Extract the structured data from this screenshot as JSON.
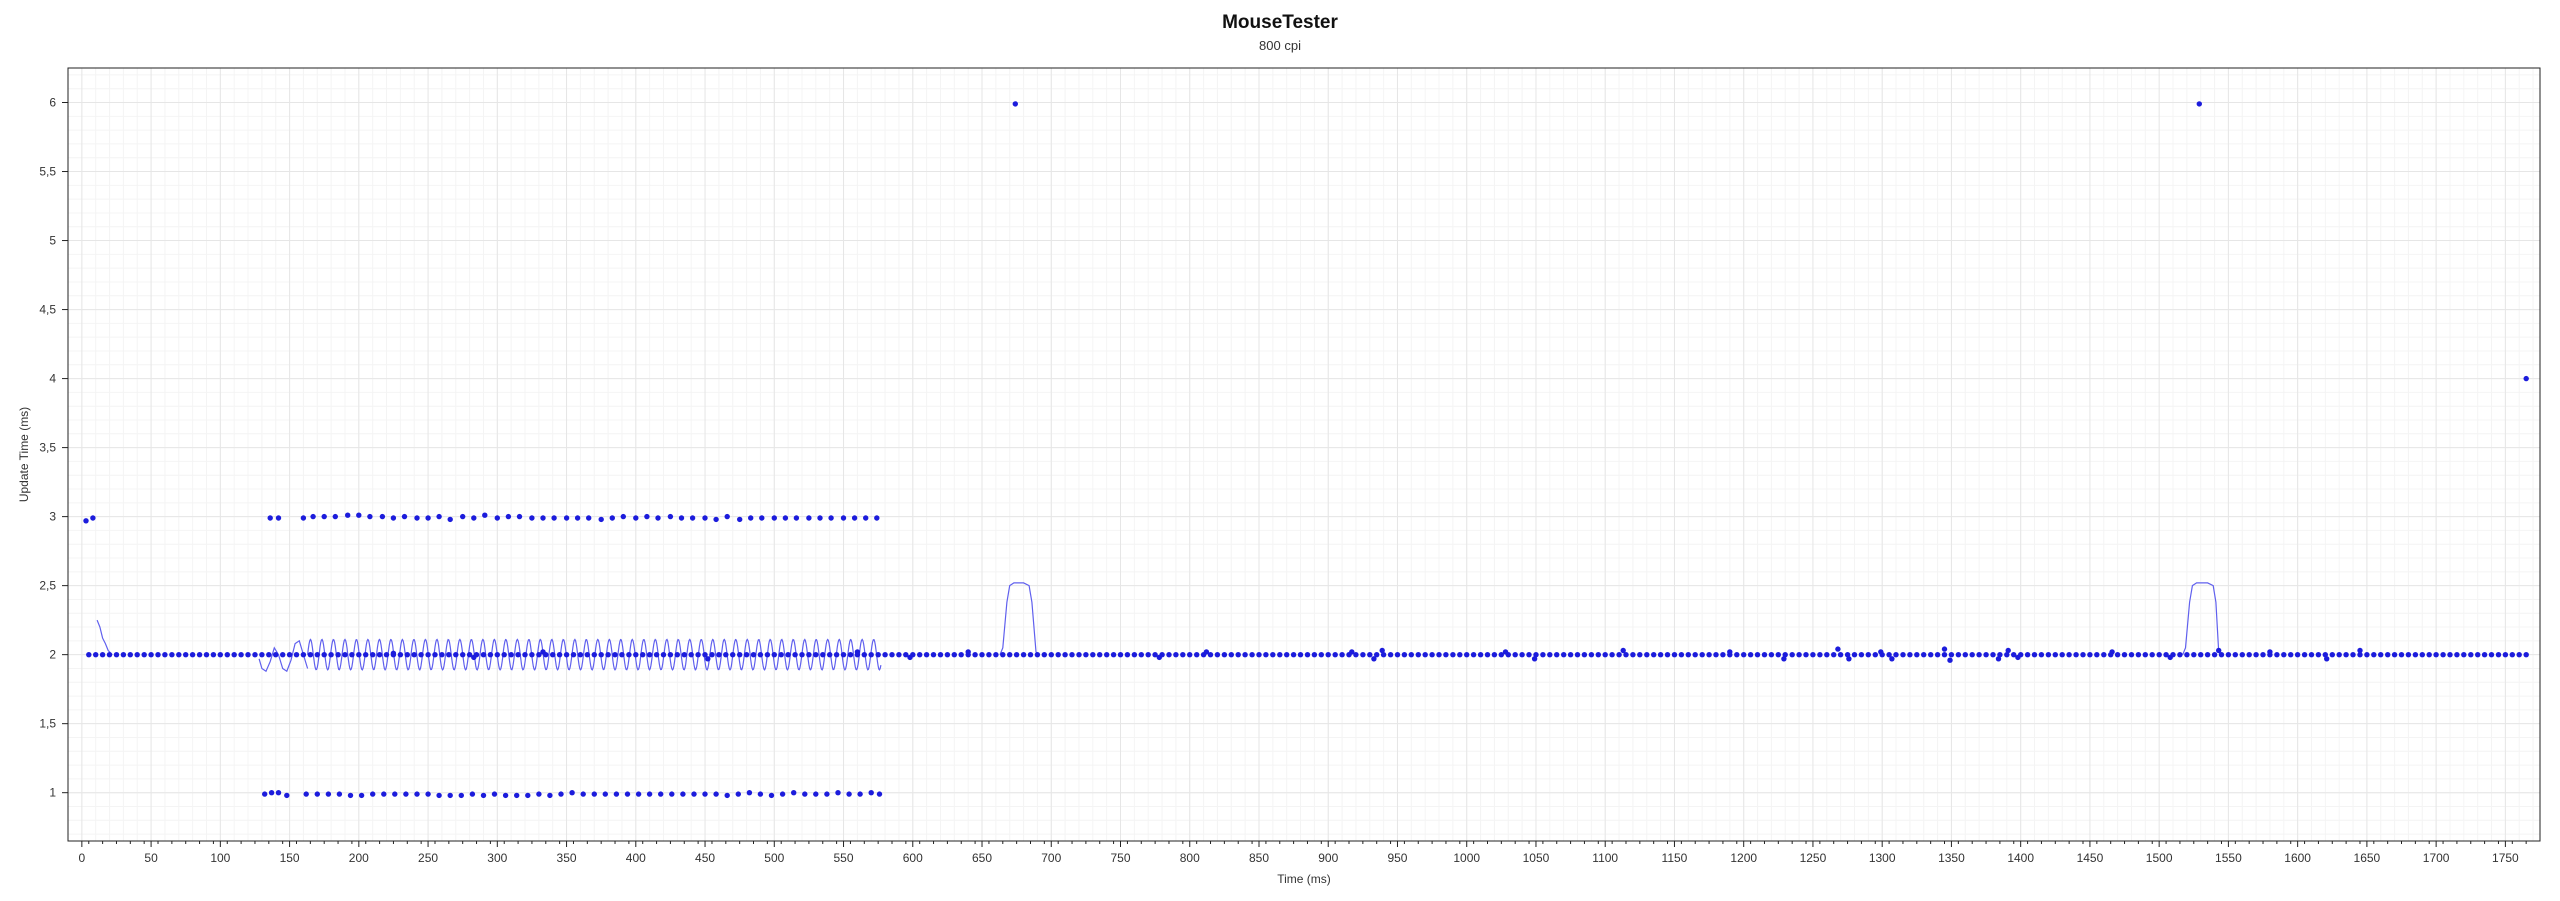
{
  "title": "MouseTester",
  "subtitle": "800 cpi",
  "chart_data": {
    "type": "scatter",
    "title": "MouseTester",
    "subtitle": "800 cpi",
    "xlabel": "Time (ms)",
    "ylabel": "Update Time (ms)",
    "xlim": [
      -10,
      1775
    ],
    "ylim": [
      0.65,
      6.25
    ],
    "grid": true,
    "legend": "none",
    "colors": {
      "series": "#1c1cdc",
      "line": "#6060ee",
      "grid_major": "#e6e6e6",
      "grid_minor": "#f4f4f4"
    },
    "x_ticks": [
      "0",
      "50",
      "100",
      "150",
      "200",
      "250",
      "300",
      "350",
      "400",
      "450",
      "500",
      "550",
      "600",
      "650",
      "700",
      "750",
      "800",
      "850",
      "900",
      "950",
      "1000",
      "1050",
      "1100",
      "1150",
      "1200",
      "1250",
      "1300",
      "1350",
      "1400",
      "1450",
      "1500",
      "1550",
      "1600",
      "1650",
      "1700",
      "1750"
    ],
    "y_ticks": [
      "1",
      "1,5",
      "2",
      "2,5",
      "3",
      "3,5",
      "4",
      "4,5",
      "5",
      "5,5",
      "6"
    ],
    "y_tick_values": [
      1,
      1.5,
      2,
      2.5,
      3,
      3.5,
      4,
      4.5,
      5,
      5.5,
      6
    ],
    "baseline_value": 2,
    "baseline_range": [
      5,
      1765
    ],
    "baseline_step": 5,
    "series": [
      {
        "name": "update-points",
        "points": [
          [
            3,
            2.97
          ],
          [
            8,
            2.99
          ],
          [
            136,
            2.99
          ],
          [
            142,
            2.99
          ],
          [
            160,
            2.99
          ],
          [
            167,
            3.0
          ],
          [
            175,
            3.0
          ],
          [
            183,
            3.0
          ],
          [
            192,
            3.01
          ],
          [
            200,
            3.01
          ],
          [
            208,
            3.0
          ],
          [
            217,
            3.0
          ],
          [
            225,
            2.99
          ],
          [
            233,
            3.0
          ],
          [
            242,
            2.99
          ],
          [
            250,
            2.99
          ],
          [
            258,
            3.0
          ],
          [
            266,
            2.98
          ],
          [
            275,
            3.0
          ],
          [
            283,
            2.99
          ],
          [
            291,
            3.01
          ],
          [
            300,
            2.99
          ],
          [
            308,
            3.0
          ],
          [
            316,
            3.0
          ],
          [
            325,
            2.99
          ],
          [
            333,
            2.99
          ],
          [
            341,
            2.99
          ],
          [
            350,
            2.99
          ],
          [
            358,
            2.99
          ],
          [
            366,
            2.99
          ],
          [
            375,
            2.98
          ],
          [
            383,
            2.99
          ],
          [
            391,
            3.0
          ],
          [
            400,
            2.99
          ],
          [
            408,
            3.0
          ],
          [
            416,
            2.99
          ],
          [
            425,
            3.0
          ],
          [
            433,
            2.99
          ],
          [
            441,
            2.99
          ],
          [
            450,
            2.99
          ],
          [
            458,
            2.98
          ],
          [
            466,
            3.0
          ],
          [
            475,
            2.98
          ],
          [
            483,
            2.99
          ],
          [
            491,
            2.99
          ],
          [
            500,
            2.99
          ],
          [
            508,
            2.99
          ],
          [
            516,
            2.99
          ],
          [
            525,
            2.99
          ],
          [
            533,
            2.99
          ],
          [
            541,
            2.99
          ],
          [
            550,
            2.99
          ],
          [
            558,
            2.99
          ],
          [
            566,
            2.99
          ],
          [
            574,
            2.99
          ],
          [
            132,
            0.99
          ],
          [
            137,
            1.0
          ],
          [
            142,
            1.0
          ],
          [
            148,
            0.98
          ],
          [
            162,
            0.99
          ],
          [
            170,
            0.99
          ],
          [
            178,
            0.99
          ],
          [
            186,
            0.99
          ],
          [
            194,
            0.98
          ],
          [
            202,
            0.98
          ],
          [
            210,
            0.99
          ],
          [
            218,
            0.99
          ],
          [
            226,
            0.99
          ],
          [
            234,
            0.99
          ],
          [
            242,
            0.99
          ],
          [
            250,
            0.99
          ],
          [
            258,
            0.98
          ],
          [
            266,
            0.98
          ],
          [
            274,
            0.98
          ],
          [
            282,
            0.99
          ],
          [
            290,
            0.98
          ],
          [
            298,
            0.99
          ],
          [
            306,
            0.98
          ],
          [
            314,
            0.98
          ],
          [
            322,
            0.98
          ],
          [
            330,
            0.99
          ],
          [
            338,
            0.98
          ],
          [
            346,
            0.99
          ],
          [
            354,
            1.0
          ],
          [
            362,
            0.99
          ],
          [
            370,
            0.99
          ],
          [
            378,
            0.99
          ],
          [
            386,
            0.99
          ],
          [
            394,
            0.99
          ],
          [
            402,
            0.99
          ],
          [
            410,
            0.99
          ],
          [
            418,
            0.99
          ],
          [
            426,
            0.99
          ],
          [
            434,
            0.99
          ],
          [
            442,
            0.99
          ],
          [
            450,
            0.99
          ],
          [
            458,
            0.99
          ],
          [
            466,
            0.98
          ],
          [
            474,
            0.99
          ],
          [
            482,
            1.0
          ],
          [
            490,
            0.99
          ],
          [
            498,
            0.98
          ],
          [
            506,
            0.99
          ],
          [
            514,
            1.0
          ],
          [
            522,
            0.99
          ],
          [
            530,
            0.99
          ],
          [
            538,
            0.99
          ],
          [
            546,
            1.0
          ],
          [
            554,
            0.99
          ],
          [
            562,
            0.99
          ],
          [
            570,
            1.0
          ],
          [
            576,
            0.99
          ],
          [
            674,
            5.99
          ],
          [
            1529,
            5.99
          ],
          [
            1765,
            4.0
          ],
          [
            225,
            2.01
          ],
          [
            283,
            1.98
          ],
          [
            333,
            2.02
          ],
          [
            452,
            1.97
          ],
          [
            560,
            2.02
          ],
          [
            598,
            1.98
          ],
          [
            640,
            2.02
          ],
          [
            778,
            1.98
          ],
          [
            812,
            2.02
          ],
          [
            917,
            2.02
          ],
          [
            933,
            1.97
          ],
          [
            939,
            2.03
          ],
          [
            1028,
            2.02
          ],
          [
            1049,
            1.97
          ],
          [
            1113,
            2.03
          ],
          [
            1190,
            2.02
          ],
          [
            1229,
            1.97
          ],
          [
            1268,
            2.04
          ],
          [
            1276,
            1.97
          ],
          [
            1299,
            2.02
          ],
          [
            1307,
            1.97
          ],
          [
            1345,
            2.04
          ],
          [
            1349,
            1.96
          ],
          [
            1384,
            1.97
          ],
          [
            1391,
            2.03
          ],
          [
            1398,
            1.98
          ],
          [
            1466,
            2.02
          ],
          [
            1508,
            1.98
          ],
          [
            1543,
            2.03
          ],
          [
            1580,
            2.02
          ],
          [
            1621,
            1.97
          ],
          [
            1645,
            2.03
          ]
        ]
      },
      {
        "name": "smoothed-line",
        "segments": [
          [
            [
              11,
              2.25
            ],
            [
              13,
              2.2
            ],
            [
              15,
              2.12
            ],
            [
              17,
              2.08
            ],
            [
              19,
              2.03
            ],
            [
              22,
              2.0
            ]
          ],
          [
            [
              128,
              1.97
            ],
            [
              130,
              1.9
            ],
            [
              133,
              1.88
            ],
            [
              136,
              1.95
            ],
            [
              139,
              2.05
            ],
            [
              142,
              2.0
            ],
            [
              145,
              1.9
            ],
            [
              148,
              1.88
            ],
            [
              151,
              1.96
            ],
            [
              154,
              2.08
            ],
            [
              157,
              2.1
            ],
            [
              160,
              2.0
            ],
            [
              163,
              1.9
            ]
          ],
          [
            [
              663,
              2.0
            ],
            [
              665,
              2.05
            ],
            [
              668,
              2.38
            ],
            [
              670,
              2.5
            ],
            [
              673,
              2.52
            ],
            [
              676,
              2.52
            ],
            [
              680,
              2.52
            ],
            [
              684,
              2.5
            ],
            [
              686,
              2.38
            ],
            [
              689,
              2.02
            ],
            [
              691,
              2.0
            ]
          ],
          [
            [
              1517,
              2.0
            ],
            [
              1519,
              2.05
            ],
            [
              1522,
              2.38
            ],
            [
              1524,
              2.5
            ],
            [
              1527,
              2.52
            ],
            [
              1531,
              2.52
            ],
            [
              1535,
              2.52
            ],
            [
              1539,
              2.5
            ],
            [
              1541,
              2.38
            ],
            [
              1543,
              2.02
            ],
            [
              1545,
              2.0
            ]
          ]
        ],
        "oscillation": {
          "x_range": [
            163,
            577
          ],
          "center": 2.0,
          "high": 2.11,
          "low": 1.89,
          "period": 8.3
        }
      }
    ]
  }
}
